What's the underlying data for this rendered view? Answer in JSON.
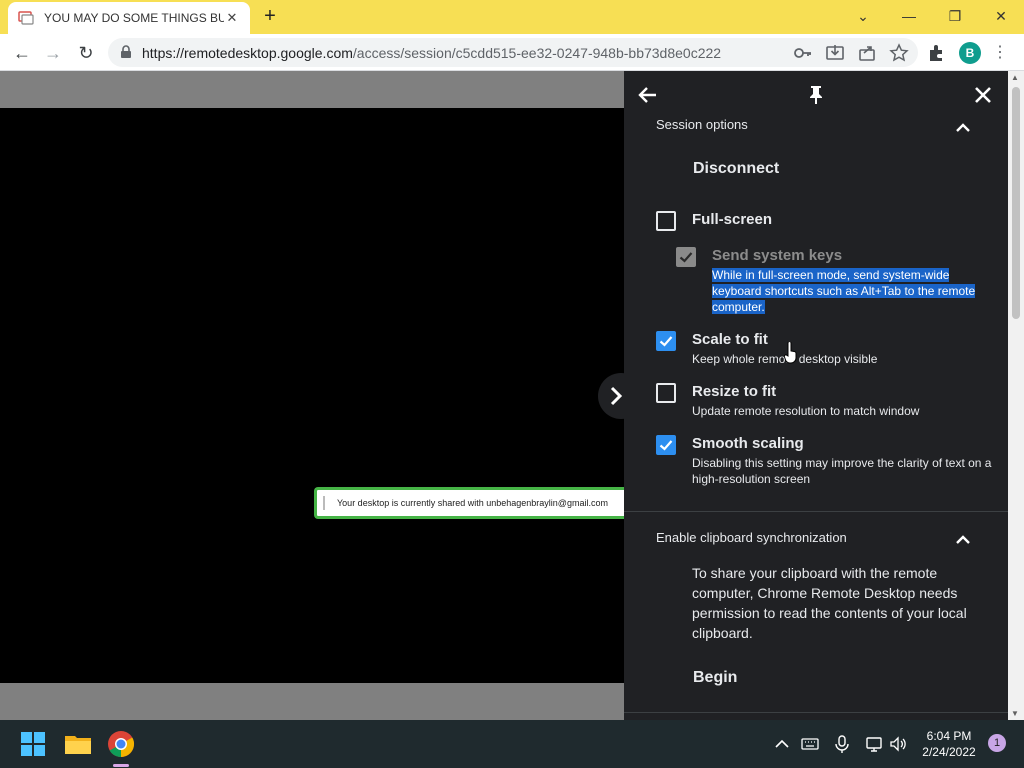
{
  "browser": {
    "tab_title": "YOU MAY DO SOME THINGS BUT",
    "url_host": "https://remotedesktop.google.com",
    "url_path": "/access/session/c5cdd515-ee32-0247-948b-bb73d8e0c222",
    "profile_initial": "B",
    "theme_color": "#f7df54"
  },
  "remote": {
    "share_message": "Your desktop is currently shared with unbehagenbraylin@gmail.com"
  },
  "panel": {
    "session_options_title": "Session options",
    "disconnect_label": "Disconnect",
    "fullscreen": {
      "label": "Full-screen",
      "checked": false
    },
    "send_system_keys": {
      "label": "Send system keys",
      "checked": true,
      "disabled": true,
      "description": "While in full-screen mode, send system-wide keyboard shortcuts such as Alt+Tab to the remote computer."
    },
    "scale_to_fit": {
      "label": "Scale to fit",
      "checked": true,
      "description": "Keep whole remote desktop visible"
    },
    "resize_to_fit": {
      "label": "Resize to fit",
      "checked": false,
      "description": "Update remote resolution to match window"
    },
    "smooth_scaling": {
      "label": "Smooth scaling",
      "checked": true,
      "description": "Disabling this setting may improve the clarity of text on a high-resolution screen"
    },
    "clipboard_title": "Enable clipboard synchronization",
    "clipboard_text": "To share your clipboard with the remote computer, Chrome Remote Desktop needs permission to read the contents of your local clipboard.",
    "begin_label": "Begin",
    "accent_color": "#2d8ff0"
  },
  "taskbar": {
    "time": "6:04 PM",
    "date": "2/24/2022",
    "notification_count": "1"
  }
}
